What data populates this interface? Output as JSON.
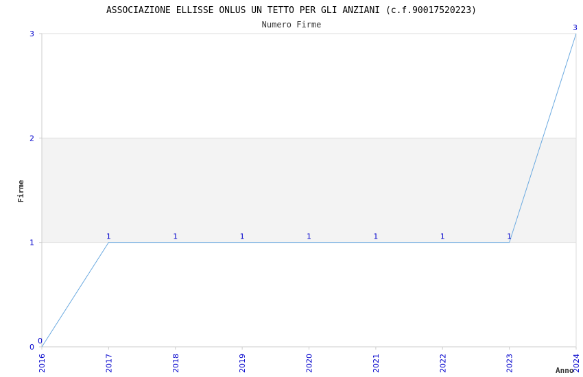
{
  "chart_data": {
    "type": "line",
    "title": "ASSOCIAZIONE ELLISSE ONLUS UN TETTO PER GLI ANZIANI (c.f.90017520223)",
    "subtitle": "Numero Firme",
    "xlabel": "Anno",
    "ylabel": "Firme",
    "categories": [
      "2016",
      "2017",
      "2018",
      "2019",
      "2020",
      "2021",
      "2022",
      "2023",
      "2024"
    ],
    "series": [
      {
        "values": [
          0,
          1,
          1,
          1,
          1,
          1,
          1,
          1,
          3
        ]
      }
    ],
    "ylim": [
      0,
      3
    ],
    "yticks": [
      "0",
      "1",
      "2",
      "3"
    ],
    "grid": true,
    "colors": {
      "line": "#6aa9e0",
      "tick_text": "#0000cc",
      "band": "#f3f3f3",
      "gridline": "#dddddd",
      "frame": "#cccccc"
    }
  }
}
